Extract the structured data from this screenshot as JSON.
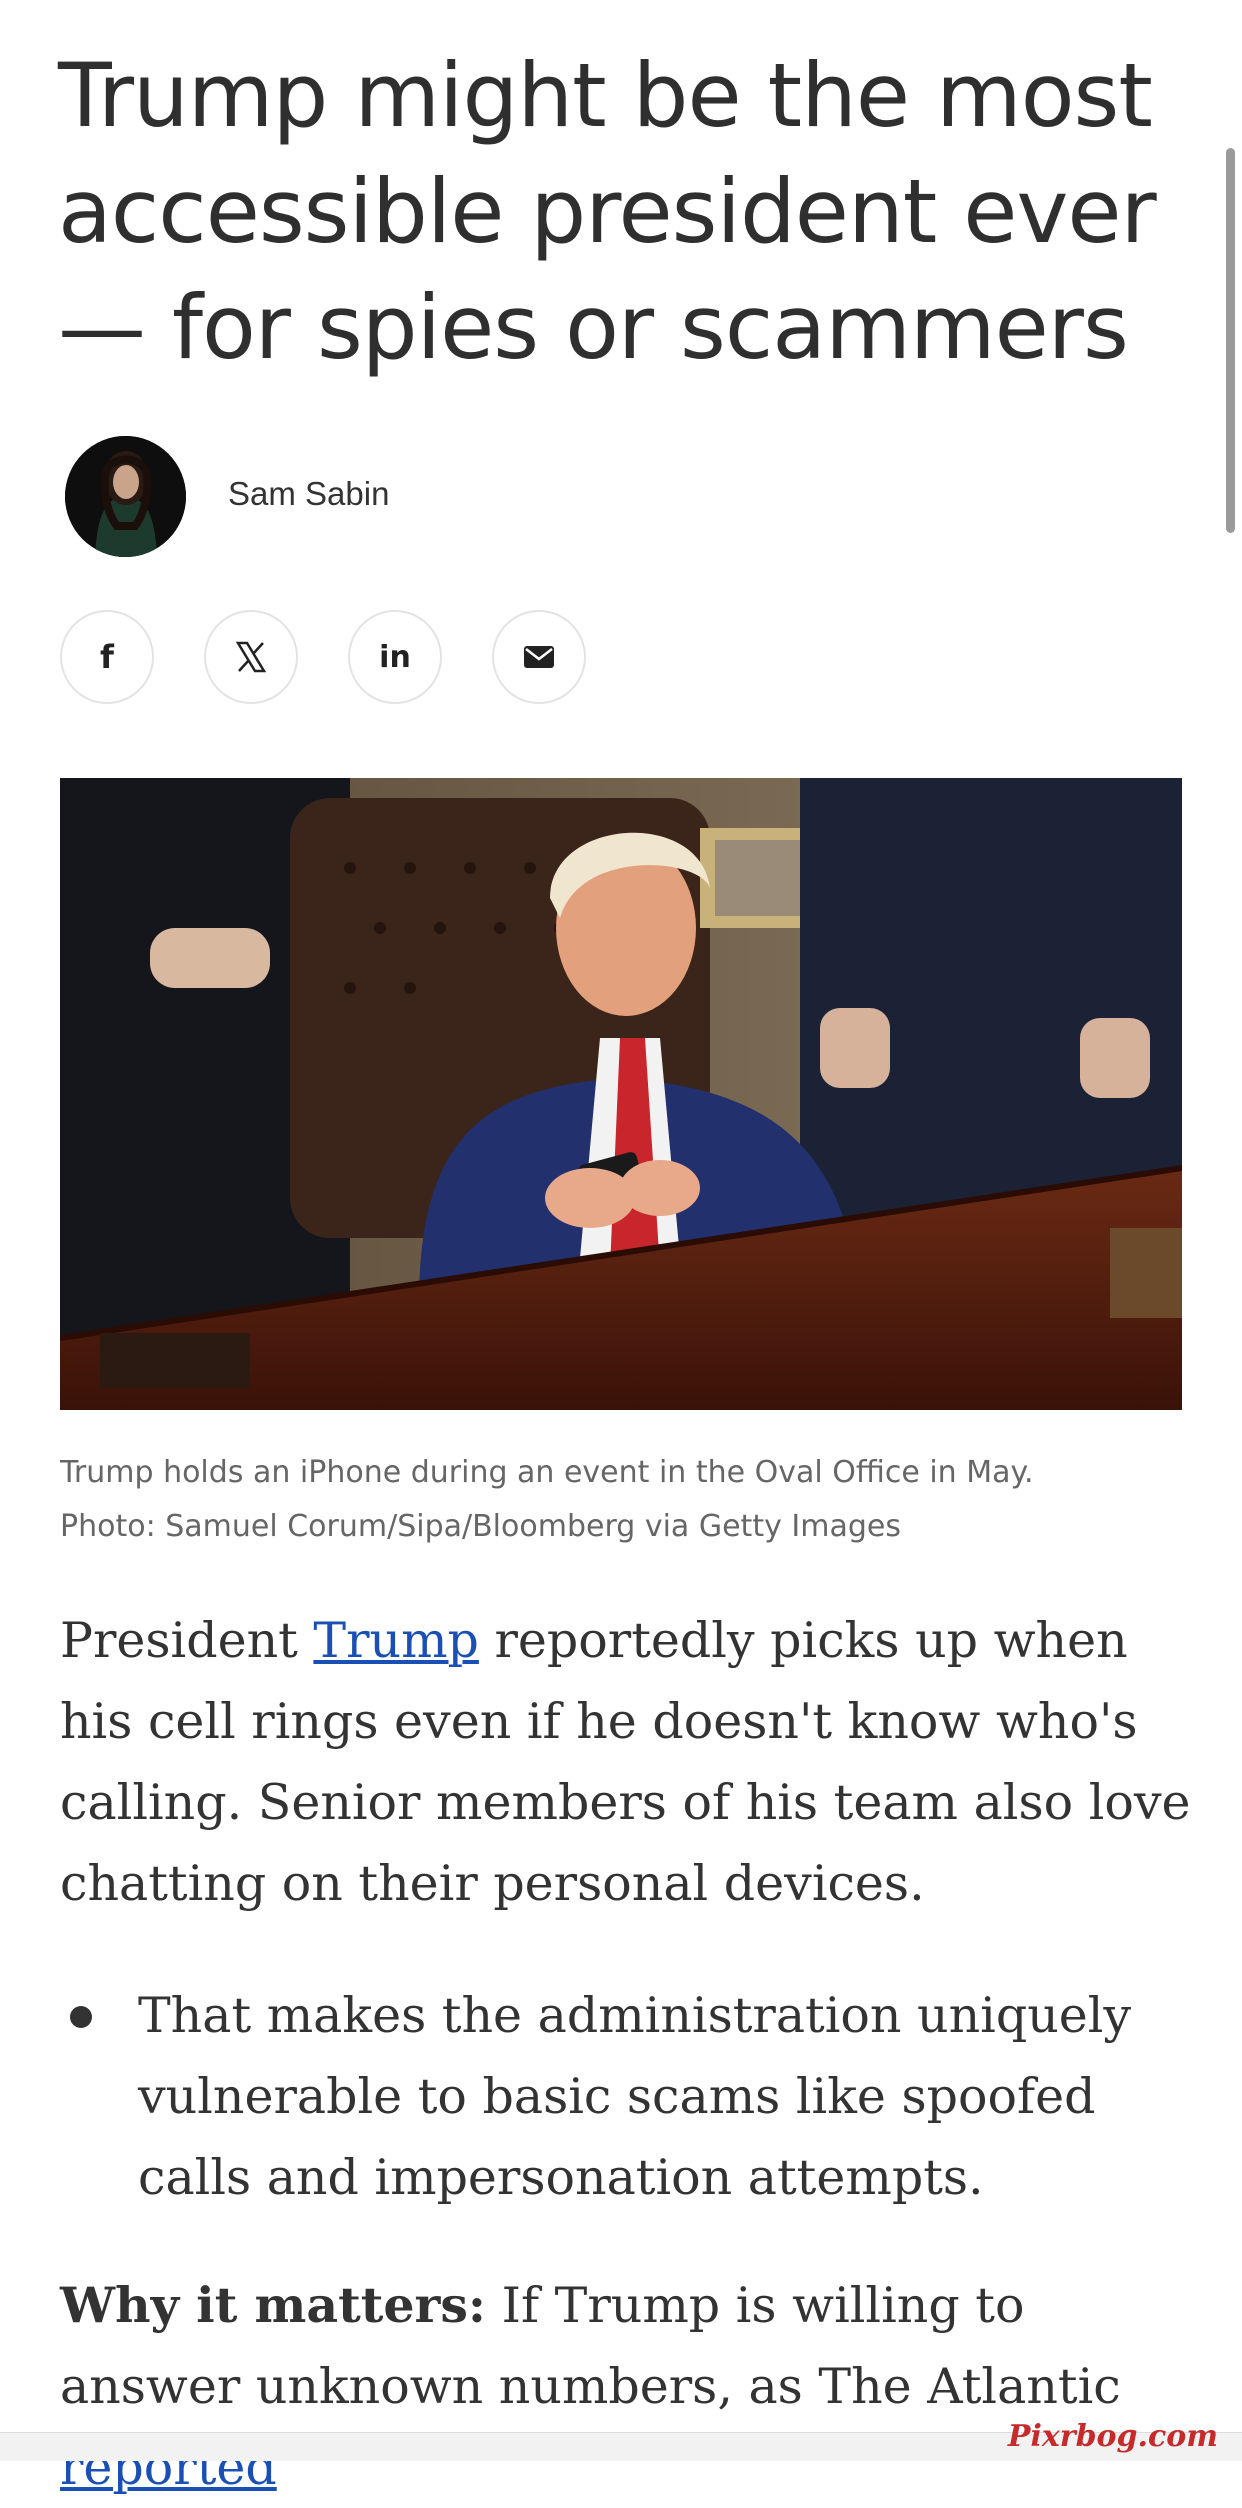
{
  "article": {
    "headline": "Trump might be the most accessible president ever — for spies or scammers",
    "author": {
      "name": "Sam Sabin"
    },
    "share": [
      {
        "icon": "facebook-icon",
        "glyph": "f"
      },
      {
        "icon": "x-icon",
        "glyph": "𝕏"
      },
      {
        "icon": "linkedin-icon",
        "glyph": "in"
      },
      {
        "icon": "email-icon",
        "glyph": "✉"
      }
    ],
    "caption": {
      "line1": "Trump holds an iPhone during an event in the Oval Office in May.",
      "line2": "Photo: Samuel Corum/Sipa/Bloomberg via Getty Images"
    },
    "paragraph1": {
      "pre": "President ",
      "link": "Trump",
      "post": " reportedly picks up when his cell rings even if he doesn't know who's calling. Senior members of his team also love chatting on their personal devices."
    },
    "bullet1": "That makes the administration uniquely vulnerable to basic scams like spoofed calls and impersonation attempts.",
    "why": {
      "label": "Why it matters:",
      "text": " If Trump is willing to answer unknown numbers, as The Atlantic ",
      "link": "reported"
    }
  },
  "watermark": "Pixrbog.com",
  "colors": {
    "link": "#1a4fb5",
    "text": "#333333",
    "caption": "#666666"
  }
}
